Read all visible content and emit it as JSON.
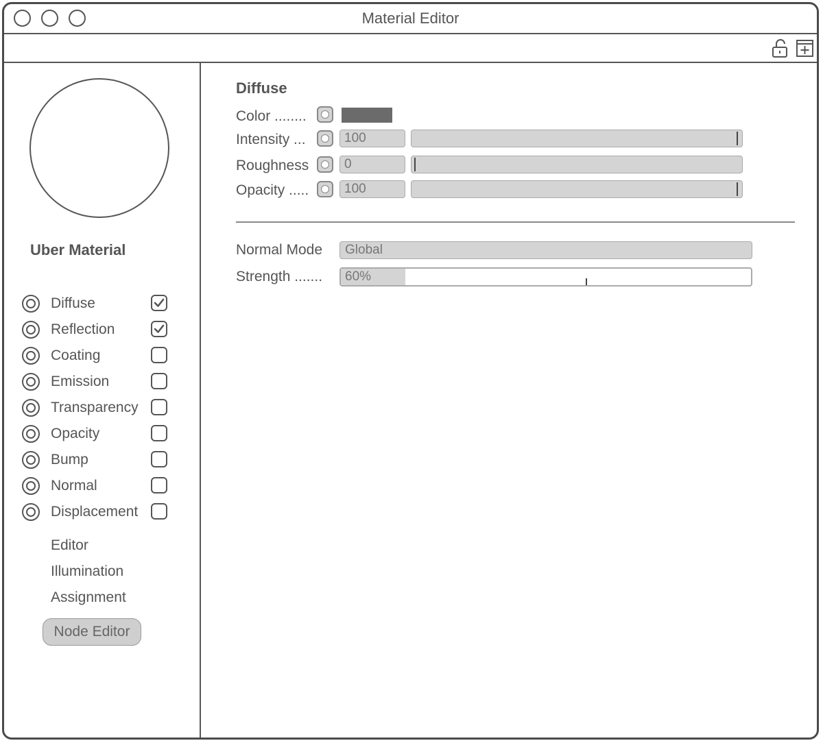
{
  "window": {
    "title": "Material Editor"
  },
  "toolbar": {
    "icons": [
      "unlock-icon",
      "new-window-icon"
    ]
  },
  "sidebar": {
    "material_name": "Uber Material",
    "channels": [
      {
        "label": "Diffuse",
        "enabled": true
      },
      {
        "label": "Reflection",
        "enabled": true
      },
      {
        "label": "Coating",
        "enabled": false
      },
      {
        "label": "Emission",
        "enabled": false
      },
      {
        "label": "Transparency",
        "enabled": false
      },
      {
        "label": "Opacity",
        "enabled": false
      },
      {
        "label": "Bump",
        "enabled": false
      },
      {
        "label": "Normal",
        "enabled": false
      },
      {
        "label": "Displacement",
        "enabled": false
      }
    ],
    "sub_items": [
      "Editor",
      "Illumination",
      "Assignment"
    ],
    "node_editor_label": "Node Editor"
  },
  "diffuse": {
    "title": "Diffuse",
    "color_label": "Color ........",
    "color_value": "#6b6b6b",
    "intensity_label": "Intensity ...",
    "intensity_value": "100",
    "intensity_fraction": 1.0,
    "roughness_label": "Roughness",
    "roughness_value": "0",
    "roughness_fraction": 0.0,
    "opacity_label": "Opacity .....",
    "opacity_value": "100",
    "opacity_fraction": 1.0
  },
  "normal": {
    "mode_label": "Normal Mode",
    "mode_value": "Global",
    "strength_label": "Strength .......",
    "strength_value": "60%",
    "strength_fraction": 0.6
  }
}
